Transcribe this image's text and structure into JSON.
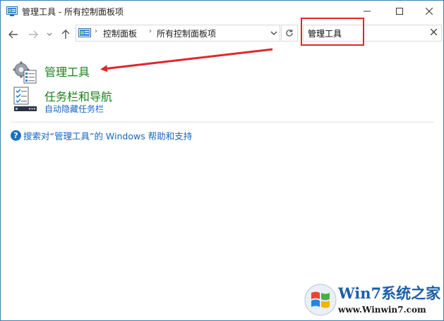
{
  "window": {
    "title": "管理工具 - 所有控制面板项"
  },
  "address": {
    "crumbs": [
      "控制面板",
      "所有控制面板项"
    ]
  },
  "search": {
    "value": "管理工具"
  },
  "results": [
    {
      "title": "管理工具",
      "subtitle": ""
    },
    {
      "title": "任务栏和导航",
      "subtitle": "自动隐藏任务栏"
    }
  ],
  "help": {
    "text": "搜索对“管理工具”的 Windows 帮助和支持"
  },
  "watermark": {
    "brand": "Win7系统之家",
    "url": "www.Winwin7.com"
  },
  "colors": {
    "accent_green": "#1a7f18",
    "link_blue": "#1565c0",
    "annotation_red": "#e0262d"
  },
  "icons": [
    "control-panel-icon",
    "minimize-icon",
    "maximize-icon",
    "close-icon",
    "back-arrow-icon",
    "forward-arrow-icon",
    "recent-chevron-icon",
    "up-arrow-icon",
    "chevron-down-icon",
    "refresh-icon",
    "clear-icon",
    "admin-tools-icon",
    "taskbar-icon",
    "help-icon",
    "windows-logo-icon"
  ]
}
